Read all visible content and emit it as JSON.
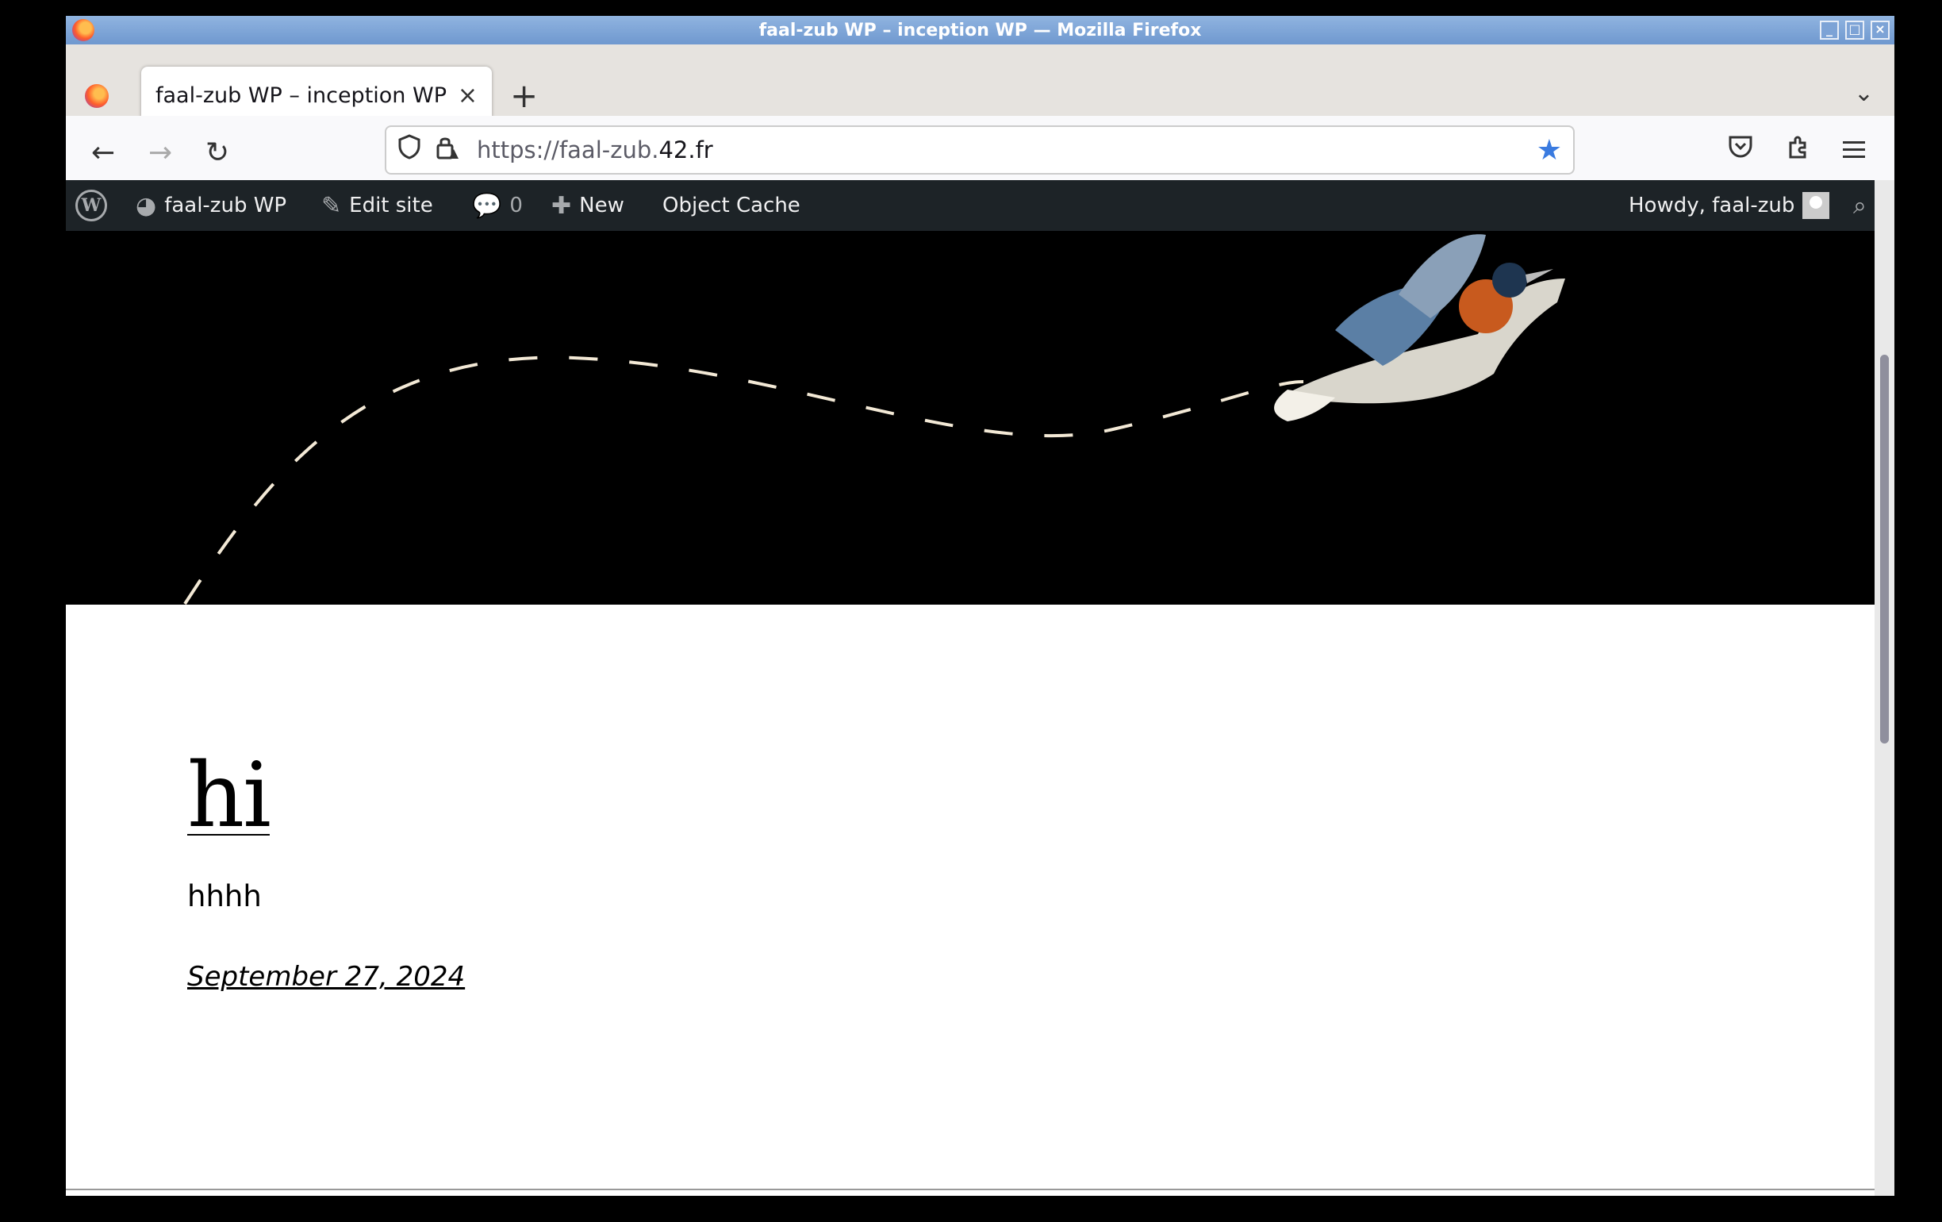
{
  "window": {
    "title": "faal-zub WP – inception WP — Mozilla Firefox",
    "controls": [
      "_",
      "□",
      "×"
    ]
  },
  "tabs": [
    {
      "label": "faal-zub WP – inception WP",
      "close": "×",
      "active": true
    }
  ],
  "new_tab_label": "+",
  "tab_list_icon": "⌄",
  "navbar": {
    "back": "←",
    "forward": "→",
    "reload": "↻",
    "url_prefix": "https://faal-zub.",
    "url_domain": "42.fr",
    "icons": [
      "shield-icon",
      "lock-warning-icon",
      "star-icon",
      "pocket-icon",
      "extensions-icon",
      "menu-icon"
    ]
  },
  "adminbar": {
    "site_name": "faal-zub WP",
    "edit_site": "Edit site",
    "comments_count": "0",
    "new_label": "New",
    "object_cache": "Object Cache",
    "howdy": "Howdy, faal-zub"
  },
  "post": {
    "title": "hi",
    "excerpt": "hhhh",
    "date": "September 27, 2024"
  },
  "colors": {
    "adminbar_bg": "#1d2327",
    "header_bg": "#000000",
    "accent_star": "#3a7be0"
  }
}
